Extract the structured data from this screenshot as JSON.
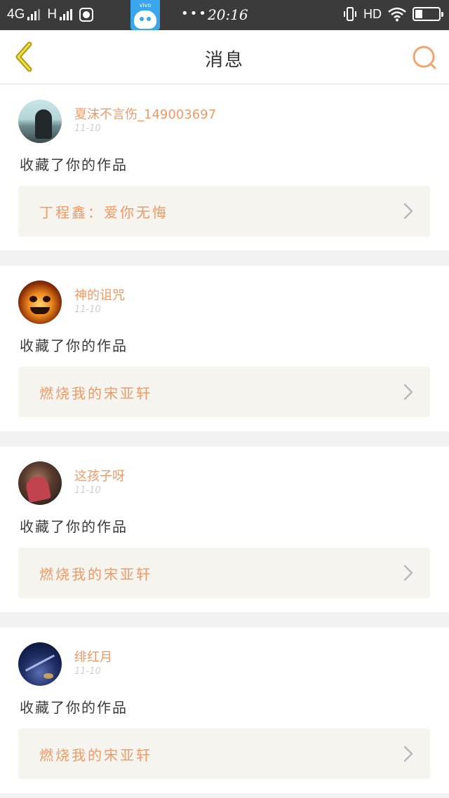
{
  "status_bar": {
    "network_left": "4G",
    "network_right": "H",
    "time": "20:16",
    "hd_label": "HD",
    "app_badge": "vivo",
    "dots": "•••",
    "battery_percent": 30
  },
  "header": {
    "title": "消息",
    "back_icon": "chevron-left-icon",
    "search_icon": "search-icon"
  },
  "accent_color": "#ef9a66",
  "messages": [
    {
      "user": "夏沫不言伤_149003697",
      "date": "11-10",
      "action": "收藏了你的作品",
      "work": "丁程鑫：爱你无悔"
    },
    {
      "user": "神的诅咒",
      "date": "11-10",
      "action": "收藏了你的作品",
      "work": "燃烧我的宋亚轩"
    },
    {
      "user": "这孩子呀",
      "date": "11-10",
      "action": "收藏了你的作品",
      "work": "燃烧我的宋亚轩"
    },
    {
      "user": "绯红月",
      "date": "11-10",
      "action": "收藏了你的作品",
      "work": "燃烧我的宋亚轩"
    }
  ]
}
